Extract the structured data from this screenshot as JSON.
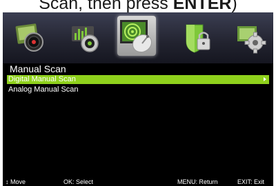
{
  "caption": {
    "prefix": "Scan, then press ",
    "key": "ENTER",
    "suffix": ")"
  },
  "icons": [
    {
      "name": "picture-icon",
      "selected": false
    },
    {
      "name": "sound-icon",
      "selected": false
    },
    {
      "name": "channel-icon",
      "selected": true
    },
    {
      "name": "lock-icon",
      "selected": false
    },
    {
      "name": "setup-icon",
      "selected": false
    }
  ],
  "menu": {
    "title": "Manual Scan",
    "items": [
      {
        "label": "Digital Manual Scan",
        "active": true
      },
      {
        "label": "Analog Manual Scan",
        "active": false
      }
    ]
  },
  "footer": {
    "move": "↕ Move",
    "select": "OK: Select",
    "return": "MENU: Return",
    "exit": "EXIT: Exit"
  },
  "colors": {
    "highlight": "#8fd11c",
    "background": "#000000",
    "text": "#ffffff"
  }
}
